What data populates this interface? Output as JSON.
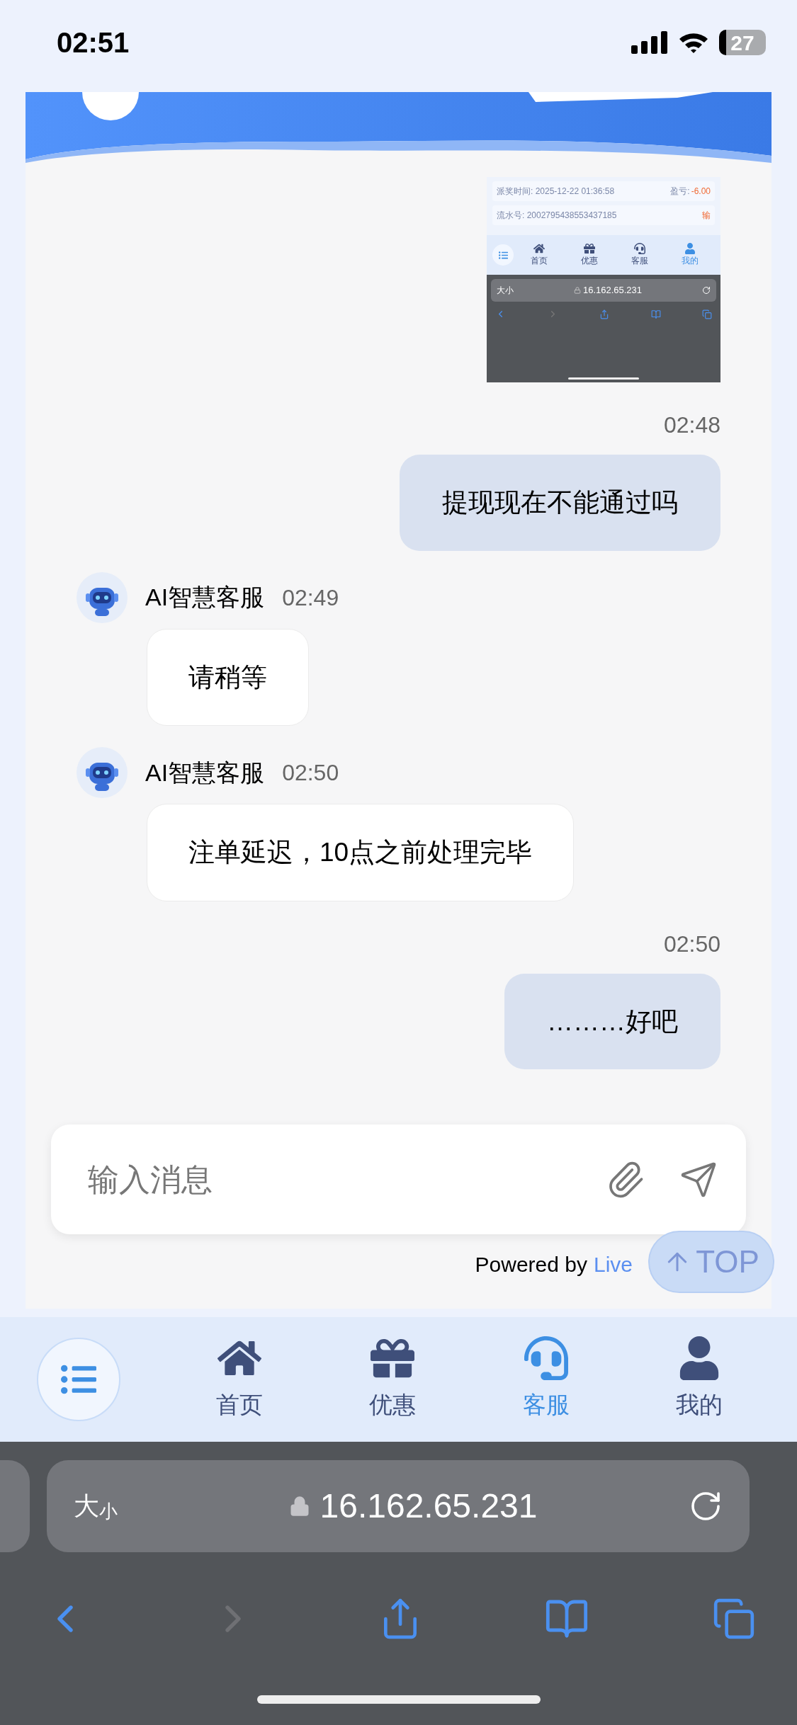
{
  "status_bar": {
    "time": "02:51",
    "battery": "27"
  },
  "messages": [
    {
      "kind": "screenshot",
      "rows": [
        {
          "label": "派奖时间: 2025-12-22 01:36:58",
          "key": "盈亏:",
          "value": "-6.00"
        },
        {
          "label": "流水号: 2002795438553437185",
          "key": "",
          "value": "输"
        }
      ],
      "tabs": [
        {
          "label": "首页",
          "selected": false
        },
        {
          "label": "优惠",
          "selected": false
        },
        {
          "label": "客服",
          "selected": false
        },
        {
          "label": "我的",
          "selected": true
        }
      ],
      "size_label": "大小",
      "url": "16.162.65.231"
    },
    {
      "kind": "sent",
      "time": "02:48",
      "text": "提现现在不能通过吗"
    },
    {
      "kind": "received",
      "sender": "AI智慧客服",
      "time": "02:49",
      "text": "请稍等"
    },
    {
      "kind": "received",
      "sender": "AI智慧客服",
      "time": "02:50",
      "text": "注单延迟，10点之前处理完毕"
    },
    {
      "kind": "sent",
      "time": "02:50",
      "text": "………好吧"
    }
  ],
  "input": {
    "placeholder": "输入消息"
  },
  "top_button": "TOP",
  "powered_by": {
    "text": "Powered by",
    "link": "Live"
  },
  "tab_bar": [
    {
      "label": "首页",
      "selected": false
    },
    {
      "label": "优惠",
      "selected": false
    },
    {
      "label": "客服",
      "selected": true
    },
    {
      "label": "我的",
      "selected": false
    }
  ],
  "browser": {
    "size_label": "大小",
    "url": "16.162.65.231",
    "forward_disabled": true
  }
}
